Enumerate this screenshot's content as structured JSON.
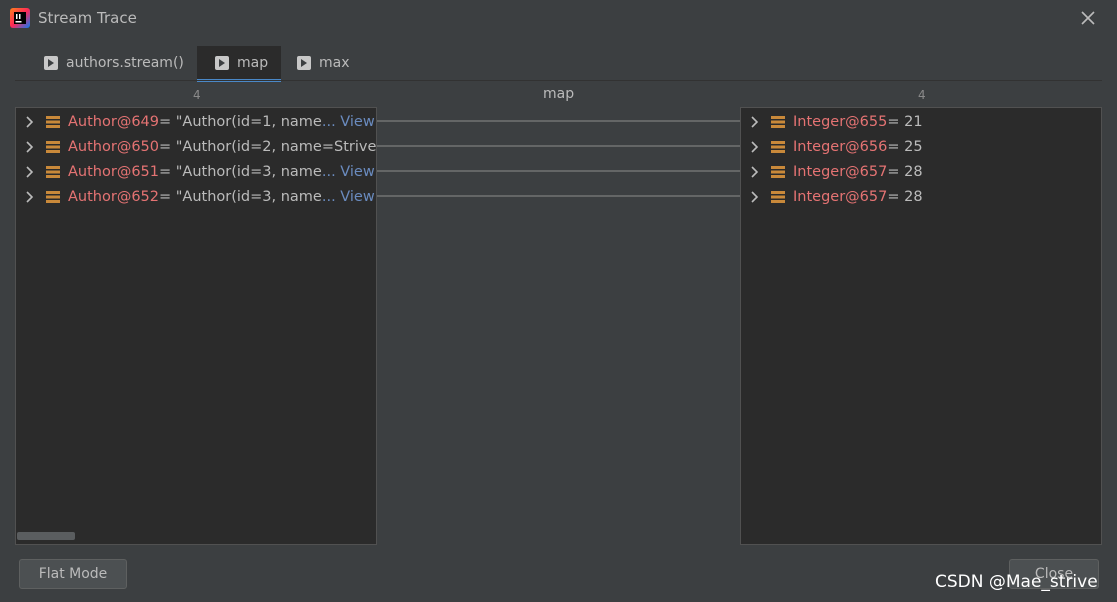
{
  "window": {
    "title": "Stream Trace"
  },
  "tabs": [
    {
      "label": "authors.stream()",
      "active": false
    },
    {
      "label": "map",
      "active": true
    },
    {
      "label": "max",
      "active": false
    }
  ],
  "left": {
    "count": "4",
    "rows": [
      {
        "ref": "Author@649",
        "value": " = \"Author(id=1, name",
        "view": "... View"
      },
      {
        "ref": "Author@650",
        "value": " = \"Author(id=2, name=Strive",
        "view": ""
      },
      {
        "ref": "Author@651",
        "value": " = \"Author(id=3, name",
        "view": "... View"
      },
      {
        "ref": "Author@652",
        "value": " = \"Author(id=3, name",
        "view": "... View"
      }
    ]
  },
  "center": {
    "label": "map"
  },
  "right": {
    "count": "4",
    "rows": [
      {
        "ref": "Integer@655",
        "value": " = 21"
      },
      {
        "ref": "Integer@656",
        "value": " = 25"
      },
      {
        "ref": "Integer@657",
        "value": " = 28"
      },
      {
        "ref": "Integer@657",
        "value": " = 28"
      }
    ]
  },
  "buttons": {
    "flat_mode": "Flat Mode",
    "close": "Close"
  },
  "watermark": "CSDN @Mae_strive",
  "colors": {
    "background": "#3c3f41",
    "panel": "#2b2b2b",
    "accent": "#4a88c7",
    "ref_text": "#e57373",
    "link": "#6a8bbf"
  },
  "icons": {
    "app": "intellij-logo-icon",
    "close": "close-icon",
    "tab": "step-icon",
    "expand": "chevron-right-icon",
    "field": "stack-icon"
  }
}
